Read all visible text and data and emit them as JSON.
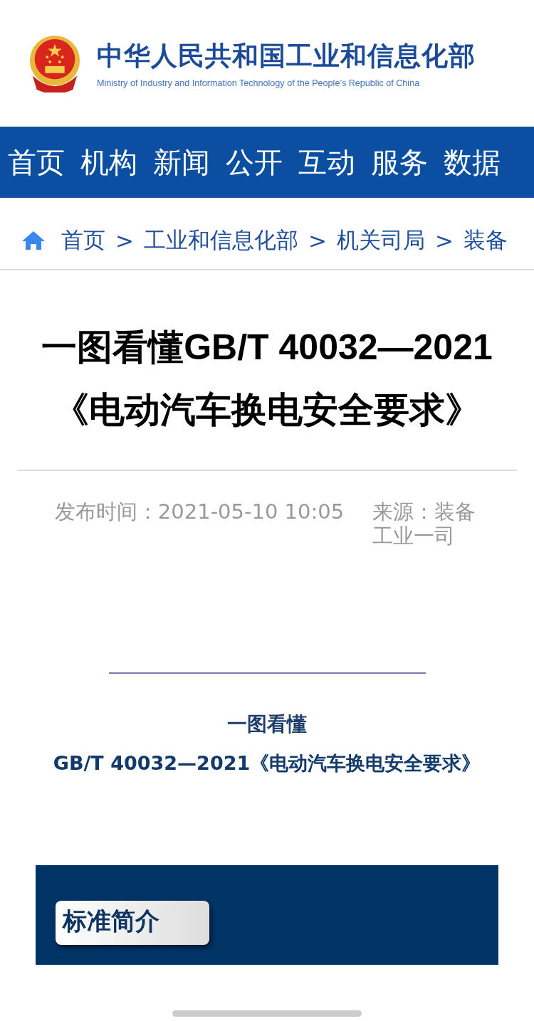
{
  "header": {
    "title": "中华人民共和国工业和信息化部",
    "subtitle": "Ministry of Industry and Information Technology of the People’s Republic of China"
  },
  "nav": [
    "首页",
    "机构",
    "新闻",
    "公开",
    "互动",
    "服务",
    "数据"
  ],
  "breadcrumb": [
    "首页",
    "工业和信息化部",
    "机关司局",
    "装备"
  ],
  "breadcrumb_separator": ">",
  "article": {
    "title": "一图看懂GB/T 40032—2021《电动汽车换电安全要求》",
    "published": "发布时间：2021-05-10 10:05",
    "source": "来源：装备工业一司"
  },
  "infographic": {
    "kicker": "一图看懂",
    "heading": "GB/T 40032—2021《电动汽车换电安全要求》",
    "section_label": "标准简介"
  }
}
